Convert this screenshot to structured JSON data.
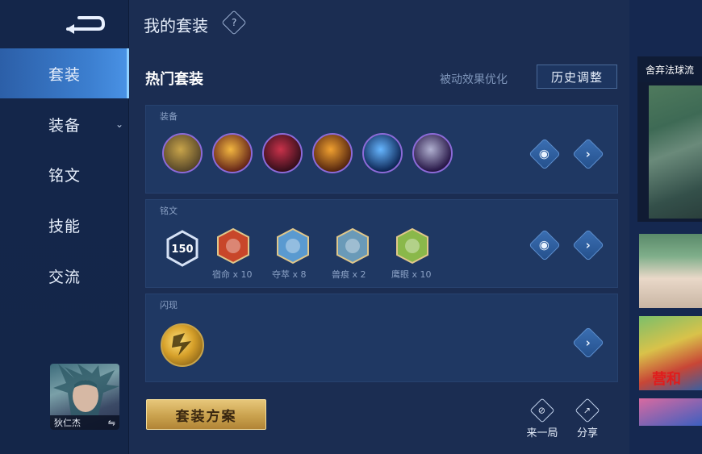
{
  "sidebar": {
    "items": [
      {
        "label": "套装",
        "active": true
      },
      {
        "label": "装备",
        "has_dropdown": true
      },
      {
        "label": "铭文"
      },
      {
        "label": "技能"
      },
      {
        "label": "交流"
      }
    ],
    "hero_name": "狄仁杰",
    "swap_glyph": "⇋"
  },
  "header": {
    "title": "我的套装",
    "help_glyph": "?"
  },
  "section": {
    "title": "热门套装",
    "passive_link": "被动效果优化",
    "history_button": "历史调整"
  },
  "equipment_panel": {
    "label": "装备",
    "items": [
      {
        "icon": "boots-icon",
        "colors": [
          "#5b4a2a",
          "#c8a44a"
        ]
      },
      {
        "icon": "golden-blade-icon",
        "colors": [
          "#6a2a1a",
          "#f2b640"
        ]
      },
      {
        "icon": "crimson-spear-icon",
        "colors": [
          "#3a0f1c",
          "#c8324a"
        ]
      },
      {
        "icon": "flame-staff-icon",
        "colors": [
          "#5a2a10",
          "#f0a030"
        ]
      },
      {
        "icon": "ice-sword-icon",
        "colors": [
          "#0f2a5a",
          "#66b6ff"
        ]
      },
      {
        "icon": "purple-gauntlet-icon",
        "colors": [
          "#2a1a4a",
          "#b0b0d0"
        ]
      }
    ]
  },
  "rune_panel": {
    "label": "铭文",
    "level": "150",
    "runes": [
      {
        "icon": "red-rune-icon",
        "label": "宿命 x 10",
        "color": "#c8462a"
      },
      {
        "icon": "blue-rune-icon",
        "label": "夺萃 x 8",
        "color": "#5a9ad0"
      },
      {
        "icon": "blue-rune-icon",
        "label": "兽痕 x 2",
        "color": "#6a9ab8"
      },
      {
        "icon": "green-rune-icon",
        "label": "鹰眼 x 10",
        "color": "#8ab84a"
      }
    ]
  },
  "skill_panel": {
    "label": "闪现",
    "icon": "flash-skill-icon"
  },
  "actions": {
    "view_glyph": "◉",
    "next_glyph": "›"
  },
  "footer": {
    "plan_button": "套装方案",
    "rematch_label": "来一局",
    "share_label": "分享"
  },
  "right_col": {
    "video_title": "舍弃法球流",
    "thumb_text": "营和"
  },
  "colors": {
    "accent": "#3c7fd0",
    "gold": "#caa24e",
    "background": "#1b2d52"
  }
}
